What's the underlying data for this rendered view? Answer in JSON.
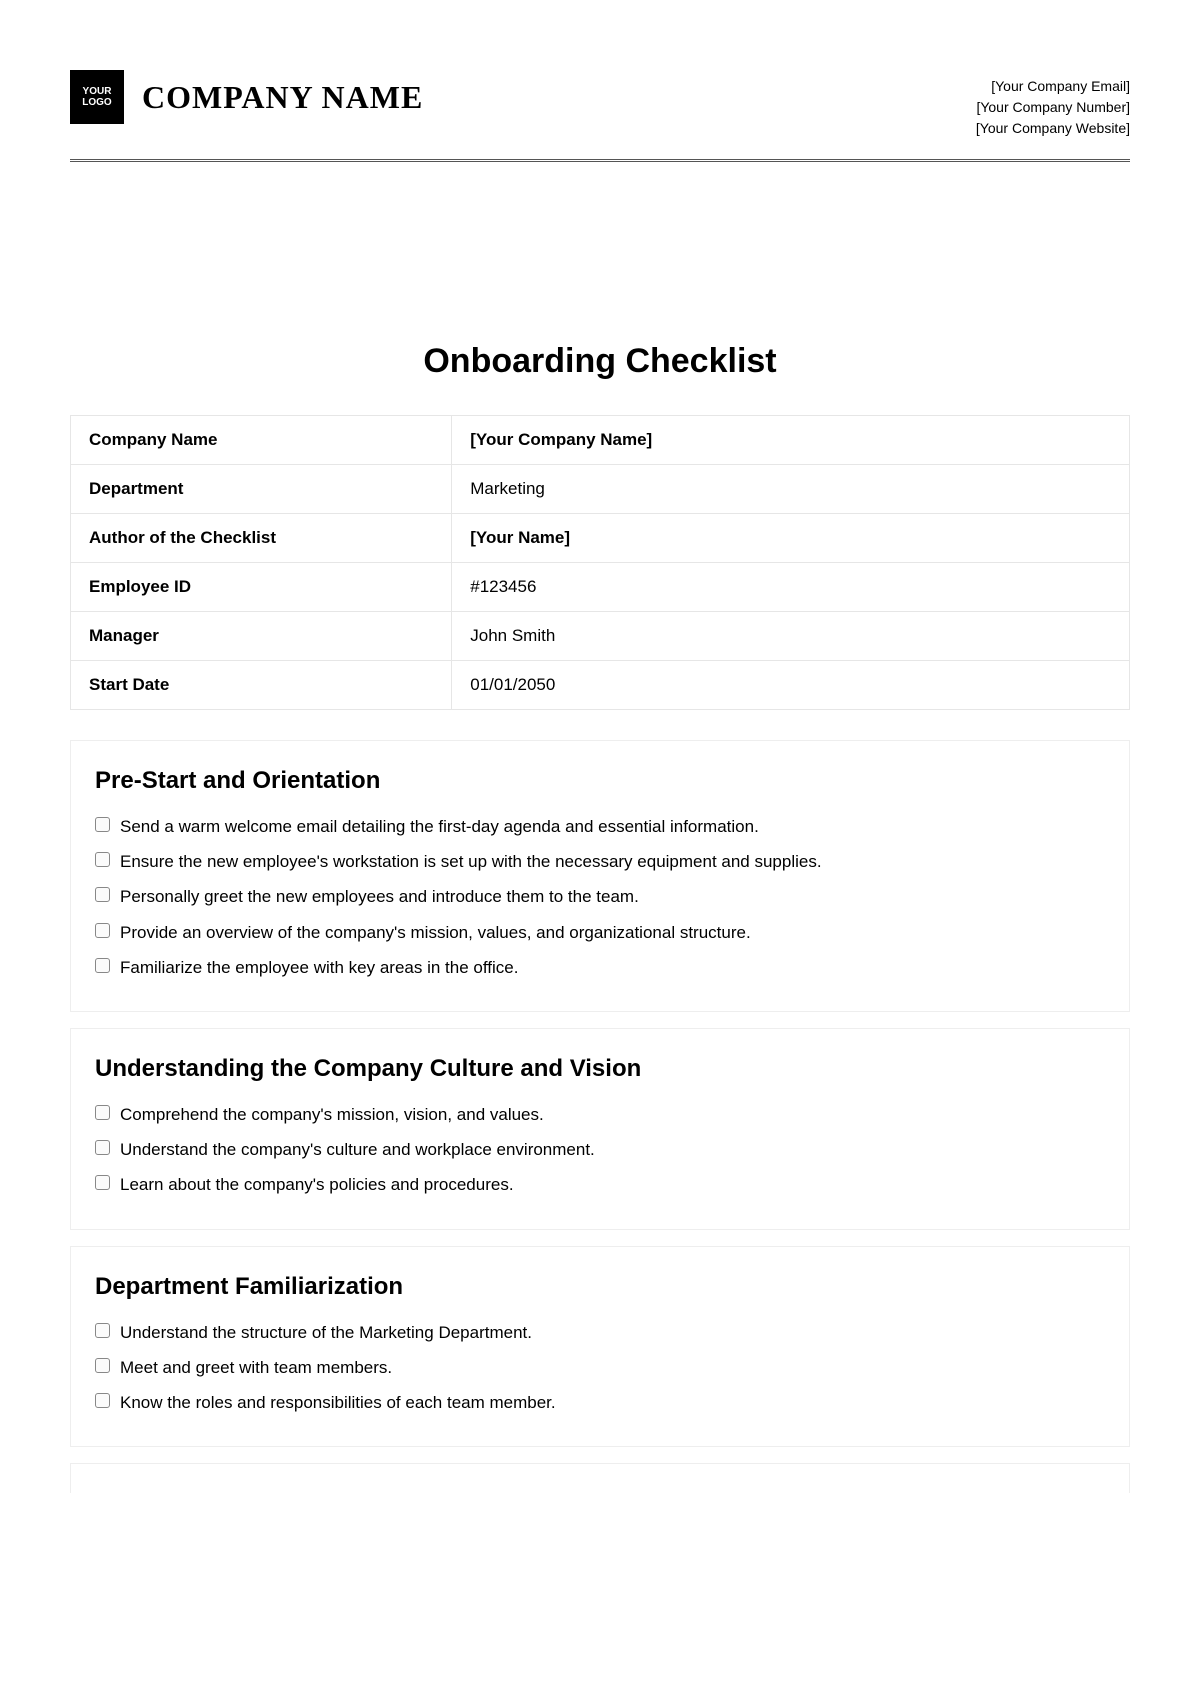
{
  "header": {
    "logo_line1": "YOUR",
    "logo_line2": "LOGO",
    "company_name": "COMPANY NAME",
    "email": "[Your Company Email]",
    "number": "[Your Company Number]",
    "website": "[Your Company Website]"
  },
  "title": "Onboarding Checklist",
  "info": [
    {
      "label": "Company Name",
      "value": "[Your Company Name]",
      "bold": true
    },
    {
      "label": "Department",
      "value": "Marketing",
      "bold": false
    },
    {
      "label": "Author of the Checklist",
      "value": "[Your Name]",
      "bold": true
    },
    {
      "label": "Employee ID",
      "value": "#123456",
      "bold": false
    },
    {
      "label": "Manager",
      "value": "John Smith",
      "bold": false
    },
    {
      "label": "Start Date",
      "value": "01/01/2050",
      "bold": false
    }
  ],
  "sections": [
    {
      "title": "Pre-Start and Orientation",
      "items": [
        "Send a warm welcome email detailing the first-day agenda and essential information.",
        "Ensure the new employee's workstation is set up with the necessary equipment and supplies.",
        "Personally greet the new employees and introduce them to the team.",
        "Provide an overview of the company's mission, values, and organizational structure.",
        "Familiarize the employee with key areas in the office."
      ]
    },
    {
      "title": "Understanding the Company Culture and Vision",
      "items": [
        "Comprehend the company's mission, vision, and values.",
        "Understand the company's culture and workplace environment.",
        "Learn about the company's policies and procedures."
      ]
    },
    {
      "title": "Department Familiarization",
      "items": [
        "Understand the structure of the Marketing Department.",
        "Meet and greet with team members.",
        "Know the roles and responsibilities of each team member."
      ]
    }
  ]
}
